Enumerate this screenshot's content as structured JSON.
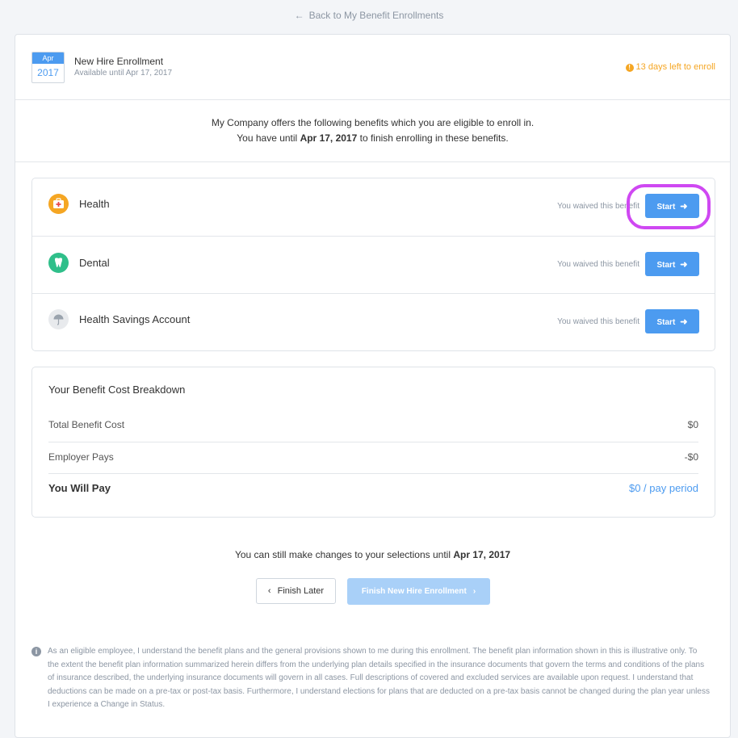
{
  "back_link": {
    "label": "Back to My Benefit Enrollments",
    "icon": "arrow-left-icon"
  },
  "enrollment": {
    "calendar_month": "Apr",
    "calendar_year": "2017",
    "title": "New Hire Enrollment",
    "subtitle": "Available until Apr 17, 2017",
    "deadline": "13 days left to enroll",
    "deadline_icon": "!"
  },
  "intro": {
    "line1": "My Company offers the following benefits which you are eligible to enroll in.",
    "line2_prefix": "You have until ",
    "line2_date": "Apr 17, 2017",
    "line2_suffix": " to finish enrolling in these benefits."
  },
  "benefits": [
    {
      "name": "Health",
      "status": "You waived this benefit",
      "button": "Start",
      "icon": "medical-kit-icon",
      "icon_color": "#f5a623"
    },
    {
      "name": "Dental",
      "status": "You waived this benefit",
      "button": "Start",
      "icon": "tooth-icon",
      "icon_color": "#2fbf8a"
    },
    {
      "name": "Health Savings Account",
      "status": "You waived this benefit",
      "button": "Start",
      "icon": "umbrella-icon",
      "icon_color": "#e8eaed"
    }
  ],
  "breakdown": {
    "title": "Your Benefit Cost Breakdown",
    "rows": [
      {
        "label": "Total Benefit Cost",
        "value": "$0"
      },
      {
        "label": "Employer Pays",
        "value": "-$0"
      },
      {
        "label": "You Will Pay",
        "value": "$0 / pay period"
      }
    ]
  },
  "changes": {
    "prefix": "You can still make changes to your selections until ",
    "date": "Apr 17, 2017"
  },
  "actions": {
    "finish_later": "Finish Later",
    "finish_enrollment": "Finish New Hire Enrollment"
  },
  "disclaimer": {
    "icon": "i",
    "text": "As an eligible employee, I understand the benefit plans and the general provisions shown to me during this enrollment. The benefit plan information shown in this is illustrative only. To the extent the benefit plan information summarized herein differs from the underlying plan details specified in the insurance documents that govern the terms and conditions of the plans of insurance described, the underlying insurance documents will govern in all cases. Full descriptions of covered and excluded services are available upon request. I understand that deductions can be made on a pre-tax or post-tax basis. Furthermore, I understand elections for plans that are deducted on a pre-tax basis cannot be changed during the plan year unless I experience a Change in Status."
  },
  "colors": {
    "accent": "#4c9bf0",
    "warning": "#f5a623",
    "highlight": "#cf48f2"
  }
}
